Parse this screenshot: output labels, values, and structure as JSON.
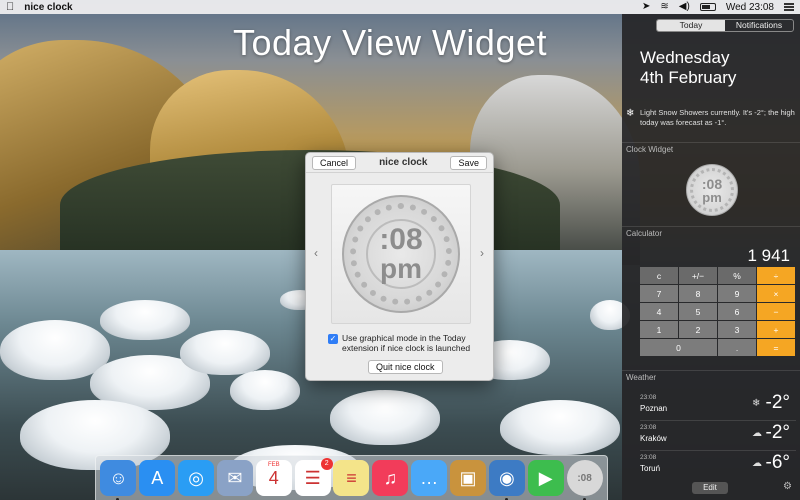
{
  "menubar": {
    "app_name": "nice clock",
    "clock": "Wed 23:08",
    "icons": [
      "apple-icon",
      "location-arrow-icon",
      "wifi-icon",
      "volume-icon",
      "battery-icon",
      "notification-centre-icon"
    ]
  },
  "desktop": {
    "title": "Today View Widget"
  },
  "dialog": {
    "title": "nice clock",
    "cancel_label": "Cancel",
    "save_label": "Save",
    "clock_minutes": ":08",
    "clock_period": "pm",
    "prev_arrow": "‹",
    "next_arrow": "›",
    "checkbox_checked": true,
    "checkbox_label": "Use graphical mode in the Today extension if nice clock is launched",
    "quit_label": "Quit nice clock"
  },
  "notification_centre": {
    "tabs": [
      {
        "label": "Today",
        "selected": true
      },
      {
        "label": "Notifications",
        "selected": false
      }
    ],
    "day": "Wednesday",
    "date": "4th February",
    "weather_summary": "Light Snow Showers currently. It's -2°; the high today was forecast as -1°.",
    "clock_widget": {
      "heading": "Clock Widget",
      "minutes": ":08",
      "period": "pm"
    },
    "calculator": {
      "heading": "Calculator",
      "display": "1 941",
      "keys": [
        {
          "label": "c",
          "kind": "fn"
        },
        {
          "label": "+/−",
          "kind": "fn"
        },
        {
          "label": "%",
          "kind": "fn"
        },
        {
          "label": "÷",
          "kind": "op"
        },
        {
          "label": "7",
          "kind": "num"
        },
        {
          "label": "8",
          "kind": "num"
        },
        {
          "label": "9",
          "kind": "num"
        },
        {
          "label": "×",
          "kind": "op"
        },
        {
          "label": "4",
          "kind": "num"
        },
        {
          "label": "5",
          "kind": "num"
        },
        {
          "label": "6",
          "kind": "num"
        },
        {
          "label": "−",
          "kind": "op"
        },
        {
          "label": "1",
          "kind": "num"
        },
        {
          "label": "2",
          "kind": "num"
        },
        {
          "label": "3",
          "kind": "num"
        },
        {
          "label": "+",
          "kind": "op"
        },
        {
          "label": "0",
          "kind": "zero"
        },
        {
          "label": ".",
          "kind": "num"
        },
        {
          "label": "=",
          "kind": "op"
        }
      ]
    },
    "weather": {
      "heading": "Weather",
      "cities": [
        {
          "time": "23:08",
          "city": "Poznan",
          "icon": "snow-icon",
          "glyph": "❄",
          "temp": "-2°"
        },
        {
          "time": "23:08",
          "city": "Kraków",
          "icon": "cloud-icon",
          "glyph": "☁",
          "temp": "-2°"
        },
        {
          "time": "23:08",
          "city": "Toruń",
          "icon": "snow-cloud-icon",
          "glyph": "☁",
          "temp": "-6°"
        }
      ]
    },
    "edit_label": "Edit"
  },
  "dock": {
    "items": [
      {
        "name": "finder-icon",
        "glyph": "☺",
        "color": "#3f8be0",
        "running": true
      },
      {
        "name": "app-store-icon",
        "glyph": "A",
        "color": "#2a8ff2",
        "running": false
      },
      {
        "name": "safari-icon",
        "glyph": "◎",
        "color": "#2a9df4",
        "running": false
      },
      {
        "name": "mail-icon",
        "glyph": "✉",
        "color": "#8aa2c6",
        "running": false
      },
      {
        "name": "calendar-icon",
        "glyph": "4",
        "color": "#ffffff",
        "running": false,
        "top": "FEB"
      },
      {
        "name": "reminders-icon",
        "glyph": "☰",
        "color": "#ffffff",
        "running": false,
        "badge": "2"
      },
      {
        "name": "notes-icon",
        "glyph": "≡",
        "color": "#f4e48a",
        "running": false
      },
      {
        "name": "itunes-icon",
        "glyph": "♫",
        "color": "#f23c5a",
        "running": false
      },
      {
        "name": "messages-icon",
        "glyph": "…",
        "color": "#4aa8f8",
        "running": false
      },
      {
        "name": "archive-utility-icon",
        "glyph": "▣",
        "color": "#c9933d",
        "running": false
      },
      {
        "name": "tweetbot-icon",
        "glyph": "◉",
        "color": "#3d7bc4",
        "running": true
      },
      {
        "name": "facetime-icon",
        "glyph": "▶",
        "color": "#3dbd4e",
        "running": false
      },
      {
        "name": "nice-clock-icon",
        "glyph": ":08",
        "color": "#d8d8d8",
        "running": true
      }
    ]
  }
}
